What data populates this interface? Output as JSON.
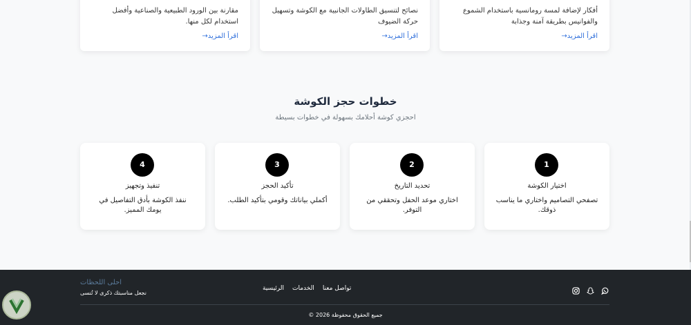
{
  "blog": {
    "cards": [
      {
        "excerpt": "أفكار لإضافة لمسة رومانسية باستخدام الشموع والفوانيس بطريقة آمنة وجذابة",
        "more": "اقرأ المزيد"
      },
      {
        "excerpt": "نصائح لتنسيق الطاولات الجانبية مع الكوشة وتسهيل حركة الضيوف",
        "more": "اقرأ المزيد"
      },
      {
        "excerpt": "مقارنة بين الورود الطبيعية والصناعية وأفضل استخدام لكل منها.",
        "more": "اقرأ المزيد"
      }
    ]
  },
  "steps": {
    "title": "خطوات حجز الكوشة",
    "subtitle": "احجزي كوشة أحلامك بسهولة في خطوات بسيطة",
    "items": [
      {
        "number": "1",
        "title": "اختيار الكوشة",
        "desc": "تصفحي التصاميم واختاري ما يناسب ذوقك."
      },
      {
        "number": "2",
        "title": "تحديد التاريخ",
        "desc": "اختاري موعد الحفل وتحققي من التوفر."
      },
      {
        "number": "3",
        "title": "تأكيد الحجز",
        "desc": "أكملي بياناتك وقومي بتأكيد الطلب."
      },
      {
        "number": "4",
        "title": "تنفيذ وتجهيز",
        "desc": "ننفذ الكوشة بأدق التفاصيل في يومك المميز."
      }
    ]
  },
  "footer": {
    "brand": "احلى اللحظات",
    "tagline": "نجعل مناسبتك ذكرى لا تُنسى",
    "nav": [
      "الرئيسية",
      "الخدمات",
      "تواصل معنا"
    ],
    "social_icons": [
      "whatsapp-icon",
      "snapchat-icon",
      "instagram-icon"
    ],
    "copyright": "جميع الحقوق محفوظة 2026 ©"
  }
}
